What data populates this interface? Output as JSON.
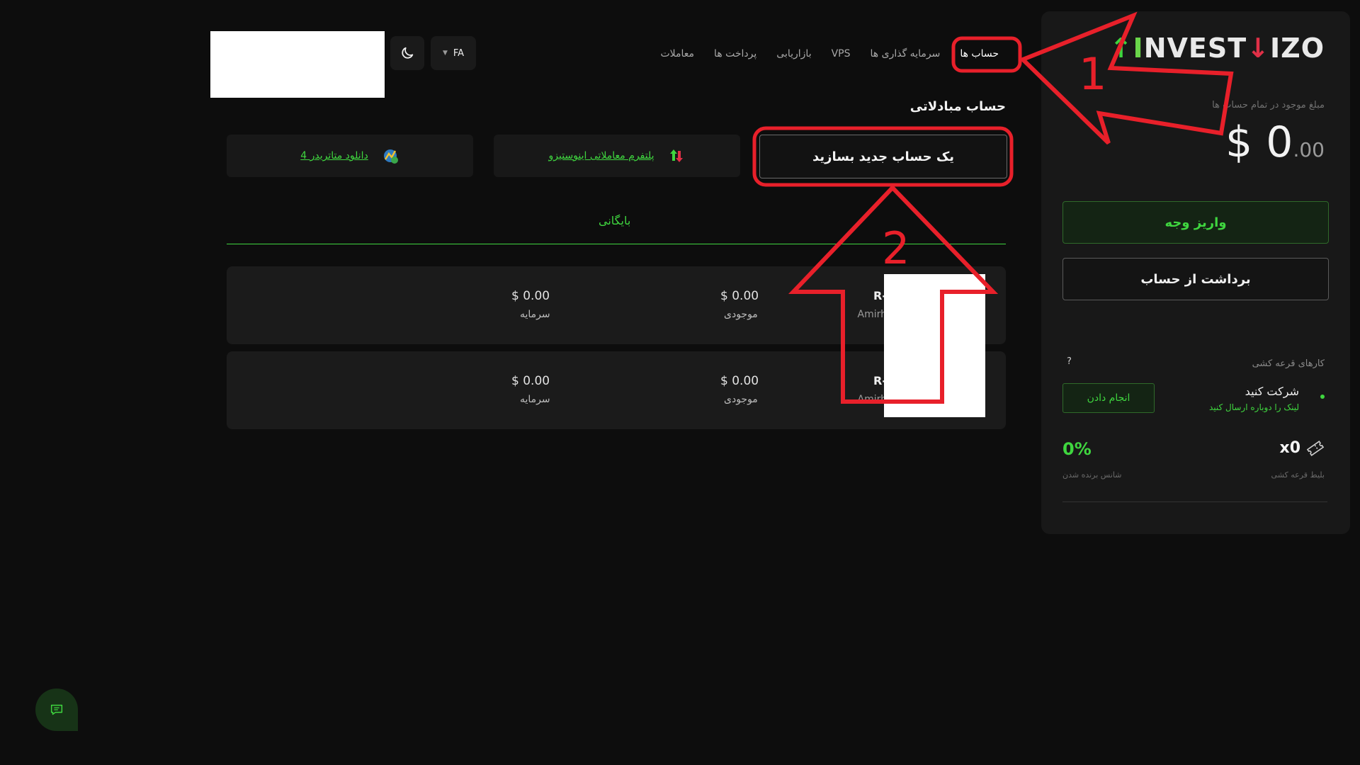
{
  "header": {
    "nav": [
      {
        "label": "حساب ها",
        "active": true
      },
      {
        "label": "سرمایه گذاری ها"
      },
      {
        "label": "VPS"
      },
      {
        "label": "بازاریابی"
      },
      {
        "label": "پرداخت ها"
      },
      {
        "label": "معاملات"
      }
    ],
    "language": "FA"
  },
  "sidebar": {
    "logo": {
      "prefix": "I",
      "rest": "NVEST",
      "i2": "I",
      "suffix": "ZO"
    },
    "balance_label": "مبلغ موجود در تمام حساب ها",
    "balance_main": "$ 0",
    "balance_cents": ".00",
    "deposit_label": "واریز وجه",
    "withdraw_label": "برداشت از حساب",
    "lottery_title": "کارهای قرعه کشی",
    "help": "?",
    "task_title": "شرکت کنید",
    "task_subtitle": "لینک را دوباره ارسال کنید",
    "task_button": "انجام دادن",
    "tickets_value": "x0",
    "tickets_label": "بلیط قرعه کشی",
    "chance_value": "0%",
    "chance_label": "شانس برنده شدن"
  },
  "main": {
    "section_title": "حساب مبادلاتی",
    "create_button": "یک حساب جدید بسازید",
    "platform_link": "پلتفرم معاملاتی اینوستیزو",
    "mt4_link": "دانلود متاتریدر 4",
    "tab_archive": "بایگانی",
    "accounts": [
      {
        "id": "R-",
        "owner": "Amirh",
        "balance": "$ 0.00",
        "balance_label": "موجودی",
        "capital": "$ 0.00",
        "capital_label": "سرمایه"
      },
      {
        "id": "R-",
        "owner": "Amirh",
        "balance": "$ 0.00",
        "balance_label": "موجودی",
        "capital": "$ 0.00",
        "capital_label": "سرمایه"
      }
    ]
  },
  "annotations": {
    "label_1": "1",
    "label_2": "2",
    "color": "#e8202a"
  }
}
